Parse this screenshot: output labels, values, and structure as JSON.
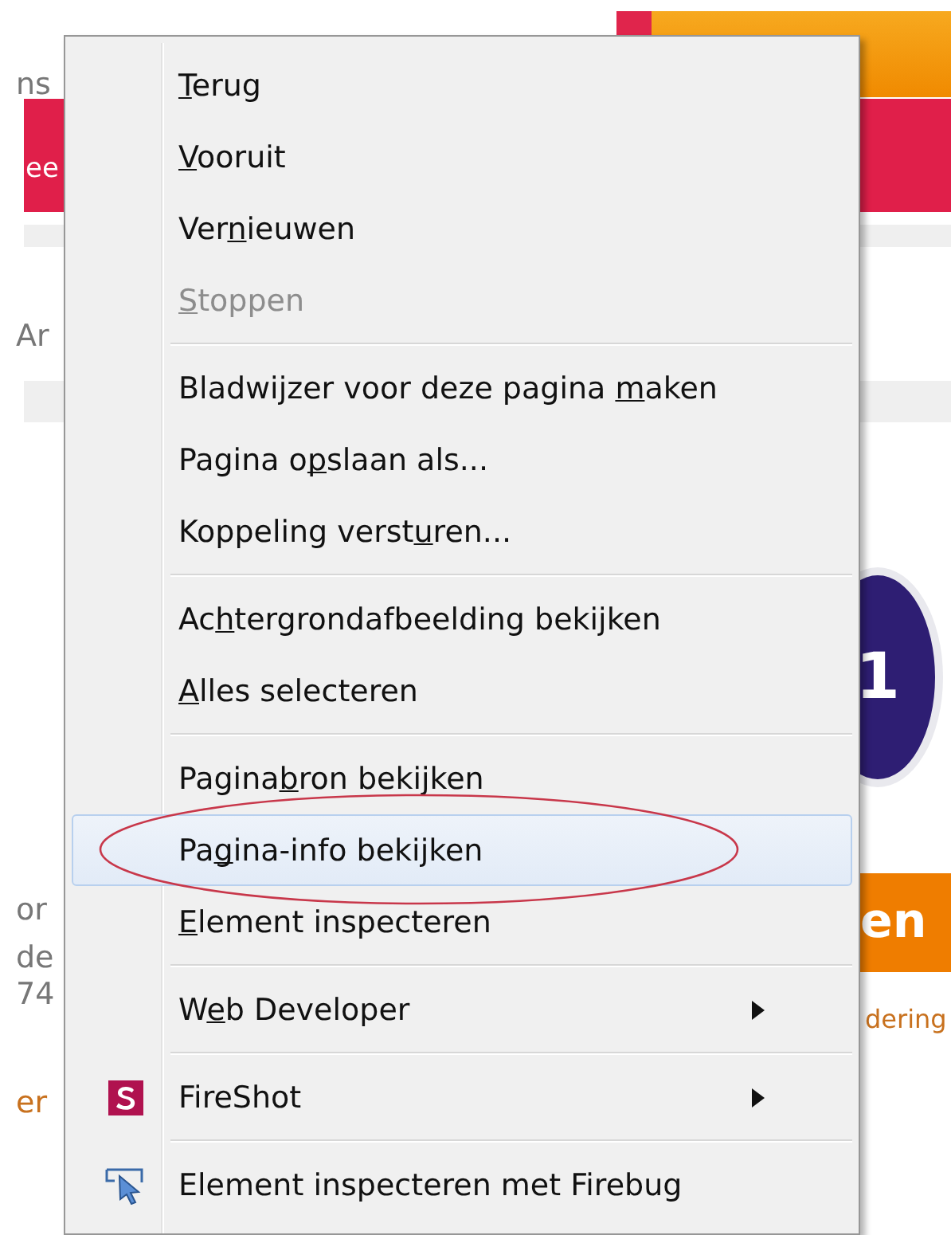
{
  "page": {
    "left_fragments": [
      {
        "text": "ns",
        "kind": "plain"
      },
      {
        "text": "ee",
        "kind": "banner"
      },
      {
        "text": "Ar",
        "kind": "plain"
      },
      {
        "text": "or",
        "kind": "plain"
      },
      {
        "text": "de",
        "kind": "plain"
      },
      {
        "text": "74",
        "kind": "plain"
      },
      {
        "text": "er",
        "kind": "link"
      }
    ],
    "badge": "1",
    "order_button": "en",
    "link_fragment": "dering"
  },
  "context_menu": {
    "items": [
      {
        "kind": "item",
        "label_parts": [
          {
            "text": "T",
            "underlined": true
          },
          {
            "text": "erug",
            "underlined": false
          }
        ],
        "disabled": false,
        "selected": false,
        "submenu": false
      },
      {
        "kind": "item",
        "label_parts": [
          {
            "text": "V",
            "underlined": true
          },
          {
            "text": "ooruit",
            "underlined": false
          }
        ],
        "disabled": false,
        "selected": false,
        "submenu": false
      },
      {
        "kind": "item",
        "label_parts": [
          {
            "text": "Ver",
            "underlined": false
          },
          {
            "text": "n",
            "underlined": true
          },
          {
            "text": "ieuwen",
            "underlined": false
          }
        ],
        "disabled": false,
        "selected": false,
        "submenu": false
      },
      {
        "kind": "item",
        "label_parts": [
          {
            "text": "S",
            "underlined": true
          },
          {
            "text": "toppen",
            "underlined": false
          }
        ],
        "disabled": true,
        "selected": false,
        "submenu": false
      },
      {
        "kind": "separator"
      },
      {
        "kind": "item",
        "label_parts": [
          {
            "text": "Bladwijzer voor deze pagina ",
            "underlined": false
          },
          {
            "text": "m",
            "underlined": true
          },
          {
            "text": "aken",
            "underlined": false
          }
        ],
        "disabled": false,
        "selected": false,
        "submenu": false
      },
      {
        "kind": "item",
        "label_parts": [
          {
            "text": "Pagina o",
            "underlined": false
          },
          {
            "text": "p",
            "underlined": true
          },
          {
            "text": "slaan als...",
            "underlined": false
          }
        ],
        "disabled": false,
        "selected": false,
        "submenu": false
      },
      {
        "kind": "item",
        "label_parts": [
          {
            "text": "Koppeling verst",
            "underlined": false
          },
          {
            "text": "u",
            "underlined": true
          },
          {
            "text": "ren...",
            "underlined": false
          }
        ],
        "disabled": false,
        "selected": false,
        "submenu": false
      },
      {
        "kind": "separator"
      },
      {
        "kind": "item",
        "label_parts": [
          {
            "text": "Ac",
            "underlined": false
          },
          {
            "text": "h",
            "underlined": true
          },
          {
            "text": "tergrondafbeelding bekijken",
            "underlined": false
          }
        ],
        "disabled": false,
        "selected": false,
        "submenu": false
      },
      {
        "kind": "item",
        "label_parts": [
          {
            "text": "A",
            "underlined": true
          },
          {
            "text": "lles selecteren",
            "underlined": false
          }
        ],
        "disabled": false,
        "selected": false,
        "submenu": false
      },
      {
        "kind": "separator"
      },
      {
        "kind": "item",
        "label_parts": [
          {
            "text": "Pagina",
            "underlined": false
          },
          {
            "text": "b",
            "underlined": true
          },
          {
            "text": "ron bekijken",
            "underlined": false
          }
        ],
        "disabled": false,
        "selected": false,
        "submenu": false
      },
      {
        "kind": "item",
        "label_parts": [
          {
            "text": "Pa",
            "underlined": false
          },
          {
            "text": "g",
            "underlined": true
          },
          {
            "text": "ina-info bekijken",
            "underlined": false
          }
        ],
        "disabled": false,
        "selected": true,
        "submenu": false,
        "circled": true
      },
      {
        "kind": "item",
        "label_parts": [
          {
            "text": "E",
            "underlined": true
          },
          {
            "text": "lement inspecteren",
            "underlined": false
          }
        ],
        "disabled": false,
        "selected": false,
        "submenu": false
      },
      {
        "kind": "separator"
      },
      {
        "kind": "item",
        "label_parts": [
          {
            "text": "W",
            "underlined": false
          },
          {
            "text": "e",
            "underlined": true
          },
          {
            "text": "b Developer",
            "underlined": false
          }
        ],
        "disabled": false,
        "selected": false,
        "submenu": true
      },
      {
        "kind": "separator"
      },
      {
        "kind": "item",
        "label_parts": [
          {
            "text": "FireShot",
            "underlined": false
          }
        ],
        "disabled": false,
        "selected": false,
        "submenu": true
      },
      {
        "kind": "separator"
      },
      {
        "kind": "item",
        "label_parts": [
          {
            "text": "Element inspecteren met Firebug",
            "underlined": false
          }
        ],
        "disabled": false,
        "selected": false,
        "submenu": false
      }
    ]
  }
}
